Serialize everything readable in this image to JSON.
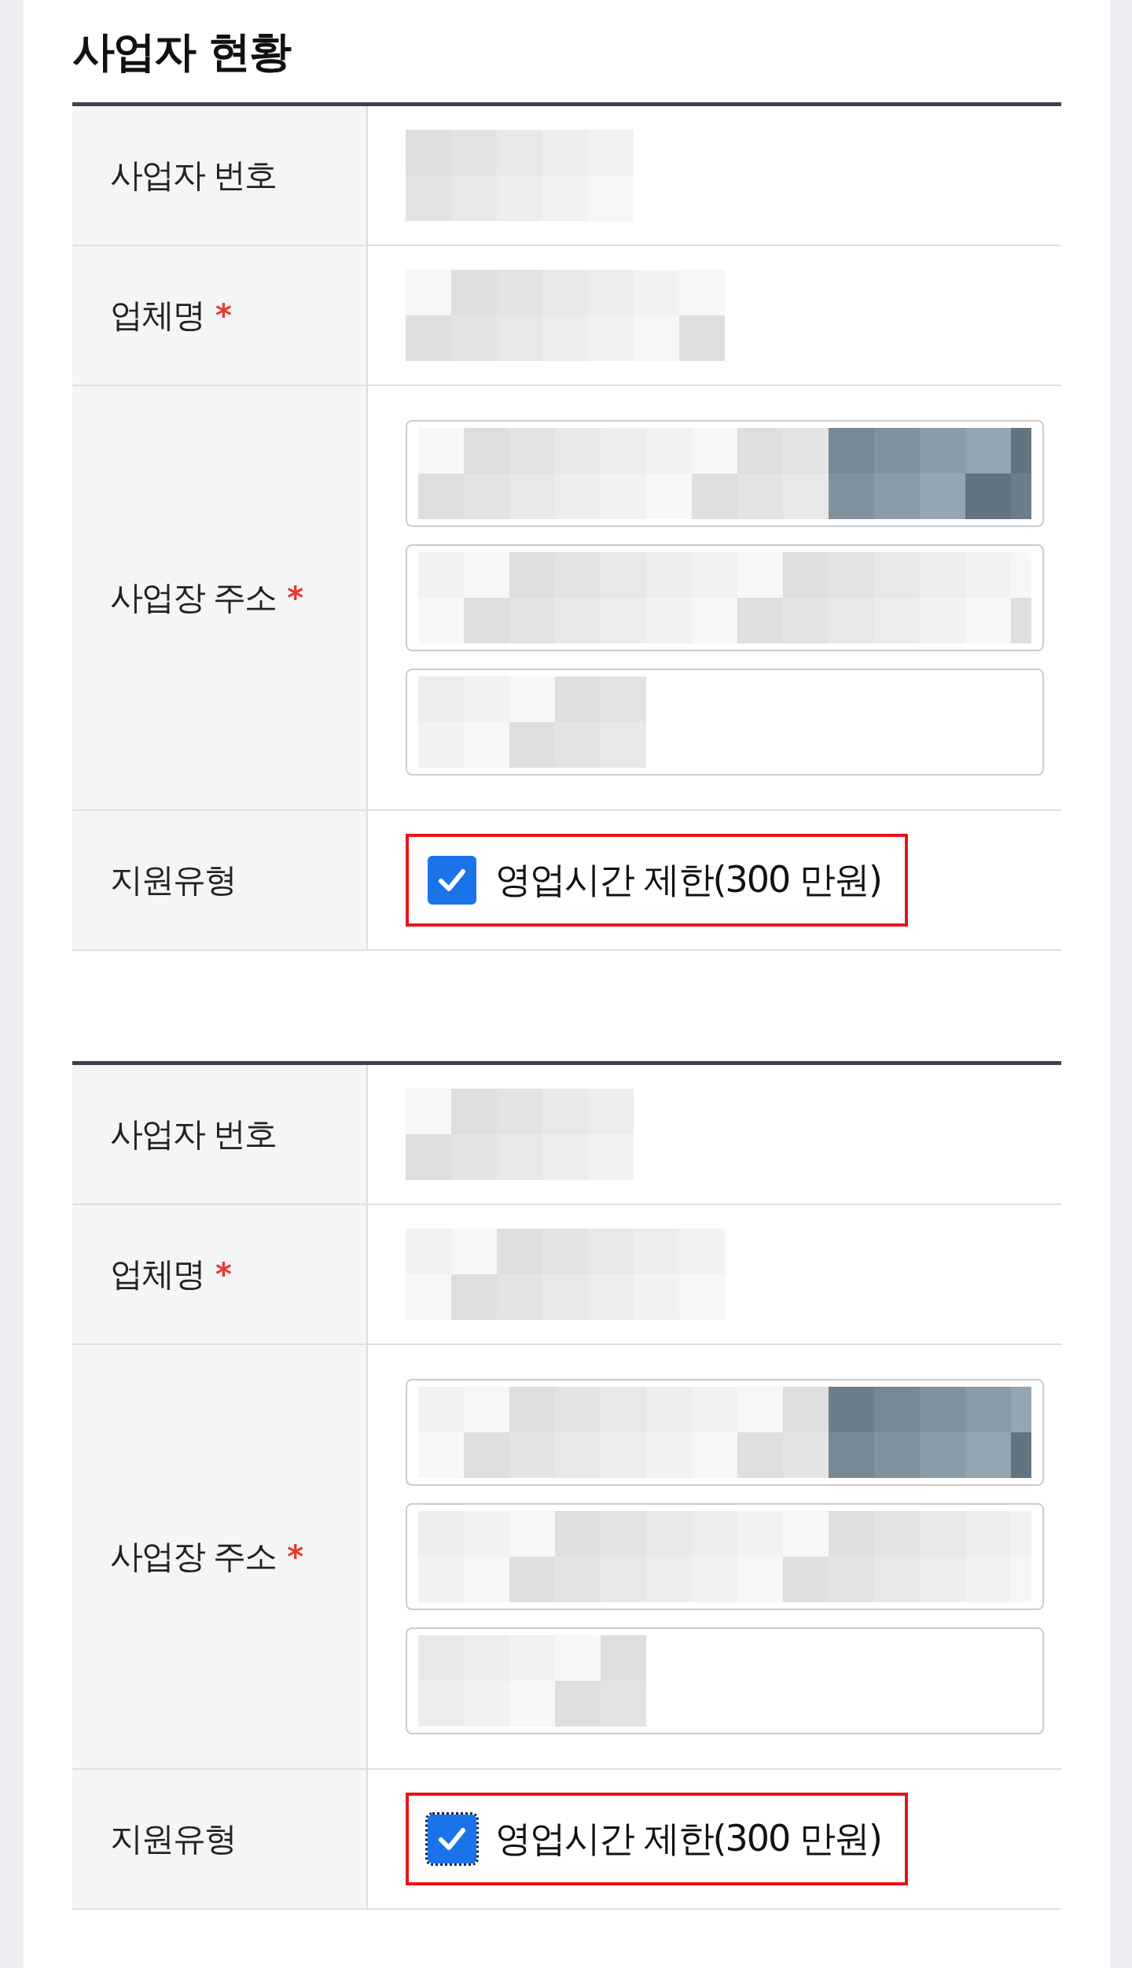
{
  "title": "사업자 현황",
  "tables": [
    {
      "rows": [
        {
          "kind": "text",
          "label": "사업자 번호"
        },
        {
          "kind": "text",
          "label": "업체명",
          "required_mark": "*"
        },
        {
          "kind": "address",
          "label": "사업장 주소",
          "required_mark": "*"
        },
        {
          "kind": "checkbox",
          "label": "지원유형",
          "option": {
            "label": "영업시간 제한(300 만원)",
            "checked": true,
            "focused": false
          }
        }
      ]
    },
    {
      "rows": [
        {
          "kind": "text",
          "label": "사업자 번호"
        },
        {
          "kind": "text",
          "label": "업체명",
          "required_mark": "*"
        },
        {
          "kind": "address",
          "label": "사업장 주소",
          "required_mark": "*"
        },
        {
          "kind": "checkbox",
          "label": "지원유형",
          "option": {
            "label": "영업시간 제한(300 만원)",
            "checked": true,
            "focused": true
          }
        }
      ]
    }
  ]
}
